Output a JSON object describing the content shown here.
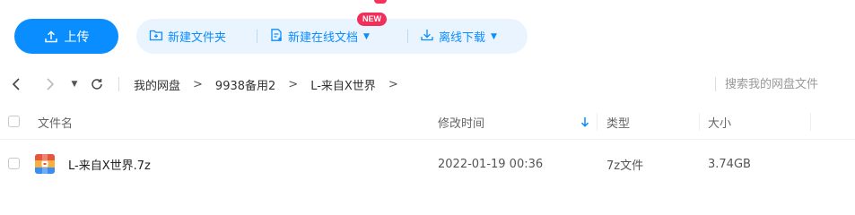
{
  "toolbar": {
    "upload_label": "上传",
    "new_folder_label": "新建文件夹",
    "new_doc_label": "新建在线文档",
    "new_badge": "NEW",
    "offline_download_label": "离线下载"
  },
  "nav": {
    "breadcrumb": [
      "我的网盘",
      "9938备用2",
      "L-来自X世界"
    ],
    "separator": ">",
    "search_placeholder": "搜索我的网盘文件",
    "search_value": ""
  },
  "table": {
    "columns": {
      "name": "文件名",
      "modified": "修改时间",
      "type": "类型",
      "size": "大小"
    },
    "sort": {
      "column": "modified",
      "direction": "desc"
    },
    "rows": [
      {
        "name": "L-来自X世界.7z",
        "modified": "2022-01-19 00:36",
        "type": "7z文件",
        "size": "3.74GB",
        "icon": "archive-file-icon"
      }
    ]
  },
  "colors": {
    "accent": "#0a8dff",
    "accent_light": "#eaf4ff",
    "badge": "#f0305a",
    "archive_orange": "#f6b03d",
    "archive_red": "#e8553f",
    "archive_blue": "#3a8ef0"
  }
}
